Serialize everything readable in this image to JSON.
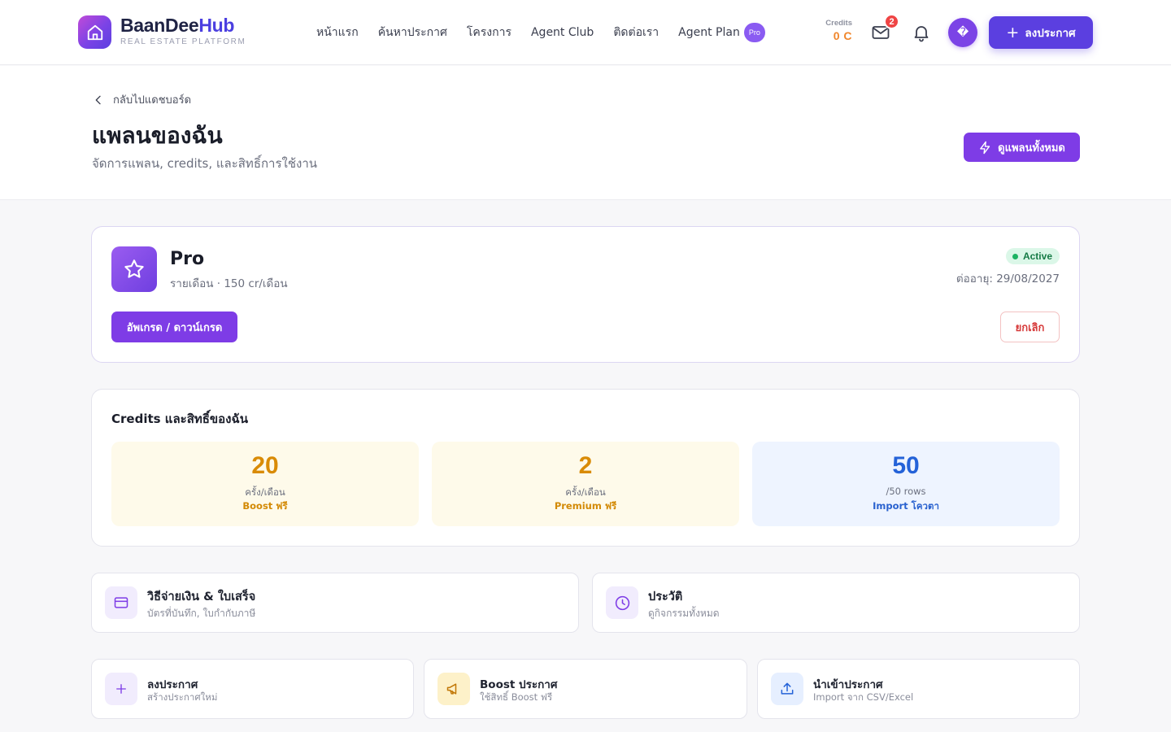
{
  "header": {
    "brand_primary": "BaanDee",
    "brand_secondary": "Hub",
    "brand_tagline": "REAL ESTATE PLATFORM",
    "nav": [
      {
        "label": "หน้าแรก"
      },
      {
        "label": "ค้นหาประกาศ"
      },
      {
        "label": "โครงการ"
      },
      {
        "label": "Agent Club"
      },
      {
        "label": "ติดต่อเรา"
      },
      {
        "label": "Agent Plan",
        "badge": "Pro"
      }
    ],
    "credits_label": "Credits",
    "credits_value": "0 C",
    "mail_badge": "2",
    "avatar_initial": "�",
    "post_button": "ลงประกาศ",
    "icons": [
      "home-icon",
      "mail-icon",
      "bell-icon",
      "plus-icon"
    ]
  },
  "hero": {
    "back_label": "กลับไปแดชบอร์ด",
    "title": "แพลนของฉัน",
    "subtitle": "จัดการแพลน, credits, และสิทธิ์การใช้งาน",
    "view_plans_button": "ดูแพลนทั้งหมด"
  },
  "plan": {
    "name": "Pro",
    "billing": "รายเดือน · 150 cr/เดือน",
    "status": "Active",
    "renewal": "ต่ออายุ: 29/08/2027",
    "upgrade_button": "อัพเกรด / ดาวน์เกรด",
    "cancel_button": "ยกเลิก"
  },
  "credits_section": {
    "title": "Credits และสิทธิ์ของฉัน",
    "stats": [
      {
        "value": "20",
        "unit": "ครั้ง/เดือน",
        "label": "Boost ฟรี"
      },
      {
        "value": "2",
        "unit": "ครั้ง/เดือน",
        "label": "Premium ฟรี"
      },
      {
        "value": "50",
        "unit": "/50 rows",
        "label": "Import โควตา"
      }
    ]
  },
  "links": [
    {
      "title": "วิธีจ่ายเงิน & ใบเสร็จ",
      "subtitle": "บัตรที่บันทึก, ใบกำกับภาษี"
    },
    {
      "title": "ประวัติ",
      "subtitle": "ดูกิจกรรมทั้งหมด"
    }
  ],
  "actions": [
    {
      "title": "ลงประกาศ",
      "subtitle": "สร้างประกาศใหม่"
    },
    {
      "title": "Boost ประกาศ",
      "subtitle": "ใช้สิทธิ์ Boost ฟรี"
    },
    {
      "title": "นำเข้าประกาศ",
      "subtitle": "Import จาก CSV/Excel"
    }
  ],
  "colors": {
    "accent": "#7e3ce6",
    "brand_blue": "#5b3fe0",
    "credit_orange": "#f0862b",
    "active_green": "#1db363",
    "danger_red": "#d63a3a"
  }
}
